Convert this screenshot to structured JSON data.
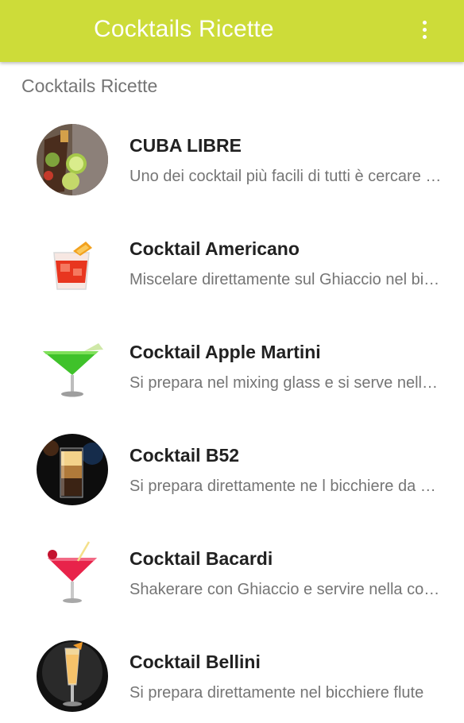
{
  "appbar": {
    "title": "Cocktails Ricette",
    "menu_icon": "overflow-menu-icon",
    "color": "#cddc39"
  },
  "section": {
    "header": "Cocktails Ricette"
  },
  "items": [
    {
      "title": "CUBA LIBRE",
      "desc": "Uno dei cocktail più facili di tutti è cercare e fare",
      "icon": "cuba-libre-image"
    },
    {
      "title": "Cocktail Americano",
      "desc": "Miscelare direttamente sul Ghiaccio nel bicchiere",
      "icon": "americano-image"
    },
    {
      "title": "Cocktail Apple Martini",
      "desc": "Si prepara nel mixing glass e si serve nella coppa",
      "icon": "apple-martini-image"
    },
    {
      "title": "Cocktail B52",
      "desc": "Si prepara direttamente ne l bicchiere da shot",
      "icon": "b52-image"
    },
    {
      "title": "Cocktail Bacardi",
      "desc": "Shakerare con Ghiaccio e servire nella coppa",
      "icon": "bacardi-image"
    },
    {
      "title": "Cocktail Bellini",
      "desc": "Si prepara direttamente nel bicchiere flute",
      "icon": "bellini-image"
    }
  ]
}
